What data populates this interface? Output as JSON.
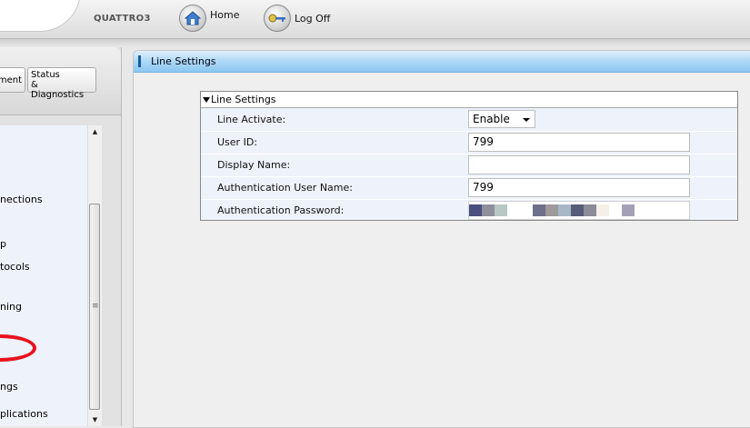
{
  "header": {
    "device_name": "QUATTRO3",
    "home_label": "Home",
    "logoff_label": "Log Off"
  },
  "left": {
    "tabs": [
      {
        "label": "ment"
      },
      {
        "label": "Status\n& Diagnostics"
      }
    ],
    "nav_items": [
      "nections",
      "p",
      "tocols",
      "ning",
      "ngs",
      "plications"
    ]
  },
  "main": {
    "title": "Line Settings",
    "section_title": "Line Settings",
    "rows": [
      {
        "label": "Line Activate:",
        "value": "Enable"
      },
      {
        "label": "User ID:",
        "value": "799"
      },
      {
        "label": "Display Name:",
        "value": ""
      },
      {
        "label": "Authentication User Name:",
        "value": "799"
      },
      {
        "label": "Authentication Password:",
        "value": ""
      }
    ]
  },
  "colors": {
    "header_blue": "#a9d6f6",
    "panel_bg": "#eef2fb",
    "annotation_red": "#e8121c"
  }
}
